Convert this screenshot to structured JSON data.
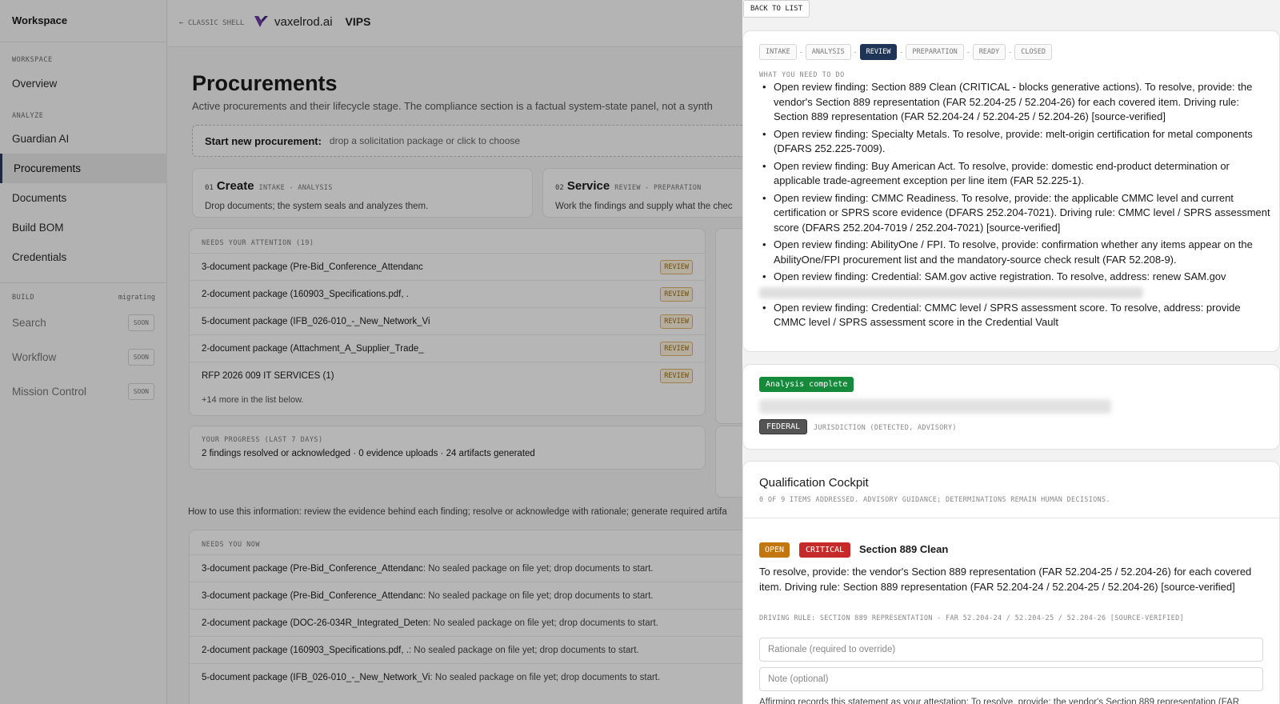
{
  "sidebar": {
    "workspace_title": "Workspace",
    "sections": {
      "workspace": "WORKSPACE",
      "analyze": "ANALYZE",
      "build": "BUILD",
      "build_status": "migrating"
    },
    "items": {
      "overview": "Overview",
      "guardian": "Guardian AI",
      "procurements": "Procurements",
      "documents": "Documents",
      "build_bom": "Build BOM",
      "credentials": "Credentials",
      "search": "Search",
      "workflow": "Workflow",
      "mission_control": "Mission Control"
    },
    "soon_label": "SOON",
    "active_item": "Procurements"
  },
  "topbar": {
    "classic_shell": "← CLASSIC SHELL",
    "brand": "vaxelrod.ai",
    "product": "VIPS",
    "brand_color": "#5b2d8f"
  },
  "main": {
    "title": "Procurements",
    "subtitle": "Active procurements and their lifecycle stage. The compliance section is a factual system-state panel, not a synth",
    "dropzone": {
      "lead": "Start new procurement:",
      "hint": "drop a solicitation package or click to choose"
    },
    "steps": [
      {
        "num": "01",
        "title": "Create",
        "sub": "INTAKE - ANALYSIS",
        "desc": "Drop documents; the system seals and analyzes them."
      },
      {
        "num": "02",
        "title": "Service",
        "sub": "REVIEW - PREPARATION",
        "desc": "Work the findings and supply what the chec"
      }
    ],
    "attention": {
      "label": "NEEDS YOUR ATTENTION (19)",
      "badge": "REVIEW",
      "rows": [
        "3-document package (Pre-Bid_Conference_Attendanc",
        "2-document package (160903_Specifications.pdf, .",
        "5-document package (IFB_026-010_-_New_Network_Vi",
        "2-document package (Attachment_A_Supplier_Trade_",
        "RFP 2026 009 IT SERVICES (1)"
      ],
      "more": "+14 more in the list below."
    },
    "progress": {
      "label": "YOUR PROGRESS (LAST 7 DAYS)",
      "text": "2 findings resolved or acknowledged · 0 evidence uploads · 24 artifacts generated"
    },
    "howto": "How to use this information: review the evidence behind each finding; resolve or acknowledge with rationale; generate required artifa",
    "needs_now": {
      "label": "NEEDS YOU NOW",
      "rows": [
        {
          "name": "3-document package (Pre-Bid_Conference_Attendanc",
          "rest": " : No sealed package on file yet; drop documents to start."
        },
        {
          "name": "3-document package (Pre-Bid_Conference_Attendanc",
          "rest": " : No sealed package on file yet; drop documents to start."
        },
        {
          "name": "2-document package (DOC-26-034R_Integrated_Deten",
          "rest": " : No sealed package on file yet; drop documents to start."
        },
        {
          "name": "2-document package (160903_Specifications.pdf, .",
          "rest": " : No sealed package on file yet; drop documents to start."
        },
        {
          "name": "5-document package (IFB_026-010_-_New_Network_Vi",
          "rest": " : No sealed package on file yet; drop documents to start."
        }
      ]
    }
  },
  "drawer": {
    "back_label": "BACK TO LIST",
    "stages": [
      "INTAKE",
      "ANALYSIS",
      "REVIEW",
      "PREPARATION",
      "READY",
      "CLOSED"
    ],
    "active_stage": "REVIEW",
    "todo_label": "WHAT YOU NEED TO DO",
    "todo": [
      "Open review finding: Section 889 Clean (CRITICAL - blocks generative actions). To resolve, provide: the vendor's Section 889 representation (FAR 52.204-25 / 52.204-26) for each covered item. Driving rule: Section 889 representation (FAR 52.204-24 / 52.204-25 / 52.204-26) [source-verified]",
      "Open review finding: Specialty Metals. To resolve, provide: melt-origin certification for metal components (DFARS 252.225-7009).",
      "Open review finding: Buy American Act. To resolve, provide: domestic end-product determination or applicable trade-agreement exception per line item (FAR 52.225-1).",
      "Open review finding: CMMC Readiness. To resolve, provide: the applicable CMMC level and current certification or SPRS score evidence (DFARS 252.204-7021). Driving rule: CMMC level / SPRS assessment score (DFARS 252.204-7019 / 252.204-7021) [source-verified]",
      "Open review finding: AbilityOne / FPI. To resolve, provide: confirmation whether any items appear on the AbilityOne/FPI procurement list and the mandatory-source check result (FAR 52.208-9).",
      "Open review finding: Credential: SAM.gov active registration. To resolve, address: renew SAM.gov",
      "Open review finding: Credential: CMMC level / SPRS assessment score. To resolve, address: provide CMMC level / SPRS assessment score in the Credential Vault"
    ],
    "analysis_badge": "Analysis complete",
    "jurisdiction_badge": "FEDERAL",
    "jurisdiction_note": "JURISDICTION (DETECTED, ADVISORY)",
    "cockpit": {
      "title": "Qualification Cockpit",
      "sub": "0 OF 9 ITEMS ADDRESSED. ADVISORY GUIDANCE; DETERMINATIONS REMAIN HUMAN DECISIONS.",
      "status_badge": "OPEN",
      "severity_badge": "CRITICAL",
      "finding_title": "Section 889 Clean",
      "finding_body": "To resolve, provide: the vendor's Section 889 representation (FAR 52.204-25 / 52.204-26) for each covered item. Driving rule: Section 889 representation (FAR 52.204-24 / 52.204-25 / 52.204-26) [source-verified]",
      "driving_rule": "DRIVING RULE: SECTION 889 REPRESENTATION - FAR 52.204-24 / 52.204-25 / 52.204-26 [SOURCE-VERIFIED]",
      "rationale_placeholder": "Rationale (required to override)",
      "note_placeholder": "Note (optional)",
      "affirm_text": "Affirming records this statement as your attestation: To resolve, provide: the vendor's Section 889 representation (FAR"
    }
  },
  "colors": {
    "active_stage": "#1f3557",
    "analysis_complete": "#148a3a",
    "open": "#c4760e",
    "critical": "#c62b2b",
    "review_badge": "#dcb36a"
  }
}
